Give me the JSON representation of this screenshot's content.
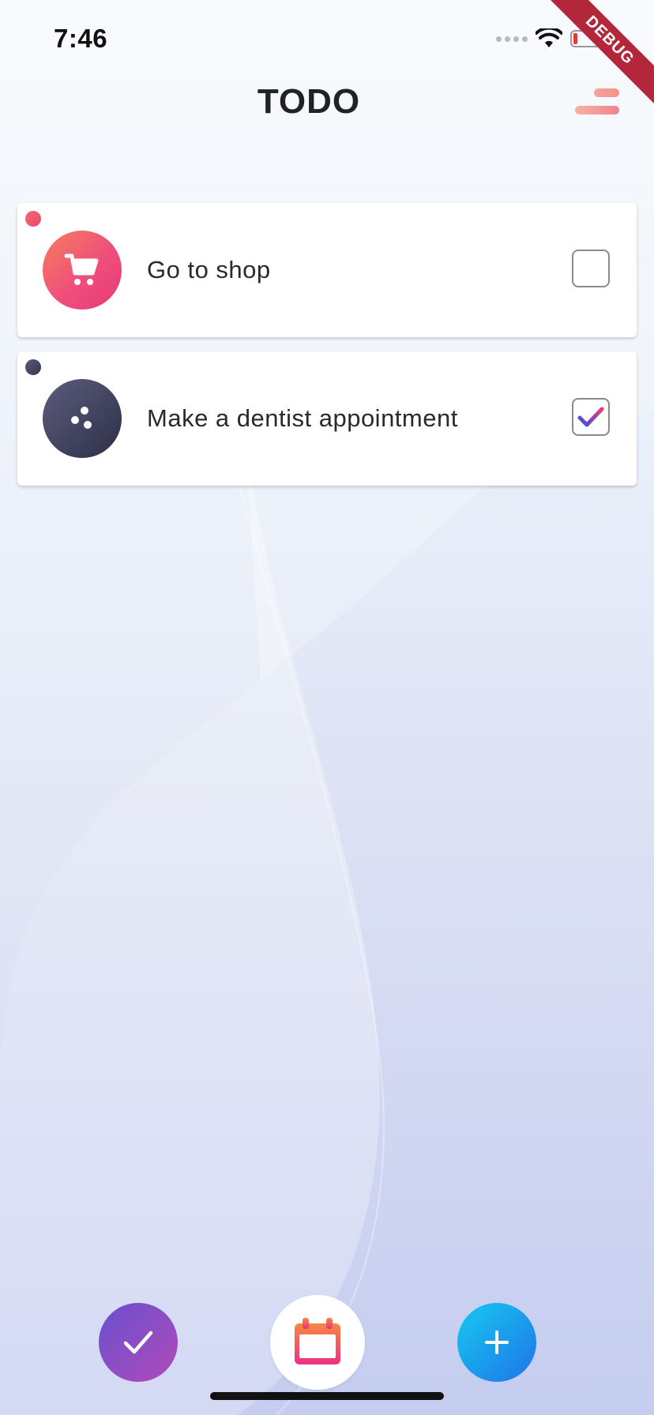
{
  "status_bar": {
    "time": "7:46"
  },
  "debug_banner": "DEBUG",
  "header": {
    "title": "TODO"
  },
  "todos": [
    {
      "label": "Go to shop",
      "checked": false,
      "icon": "shopping-cart-icon",
      "color": "#ef4f7a"
    },
    {
      "label": "Make a dentist appointment",
      "checked": true,
      "icon": "dental-dots-icon",
      "color": "#34354f"
    }
  ],
  "bottom_bar": {
    "done_icon": "check-icon",
    "calendar_icon": "calendar-icon",
    "add_icon": "plus-icon"
  },
  "colors": {
    "accent_pink": "#ef4f7a",
    "accent_purple": "#6a4fd0",
    "accent_blue": "#1f74e8",
    "menu_coral": "#f4a3a0"
  }
}
